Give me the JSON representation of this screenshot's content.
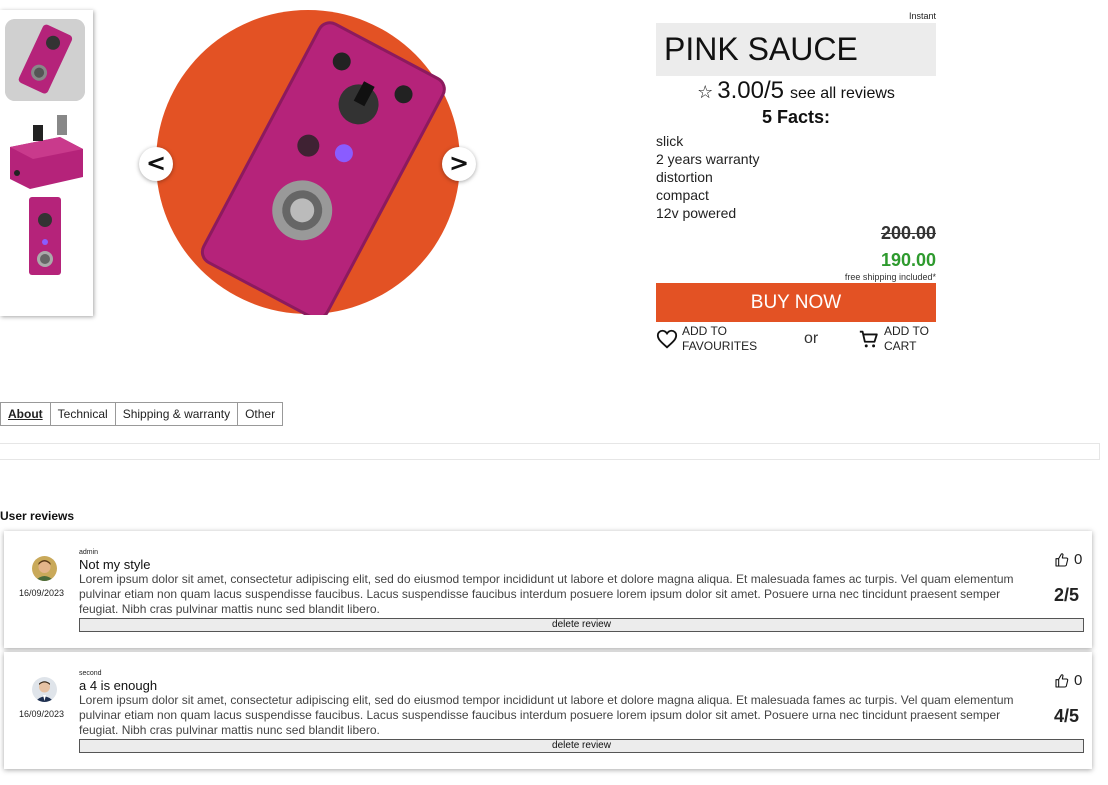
{
  "gallery": {
    "thumbnails": [
      "pedal-angled-icon",
      "pedal-side-icon",
      "pedal-top-icon"
    ],
    "prev_label": "<",
    "next_label": ">"
  },
  "product": {
    "badge": "Instant",
    "name": "PINK SAUCE",
    "rating_score": "3.00/5",
    "see_reviews_label": "see all reviews",
    "facts_title": "5 Facts:",
    "facts": [
      "slick",
      "2 years warranty",
      "distortion",
      "compact",
      "12v powered"
    ],
    "old_price": "200.00",
    "new_price": "190.00",
    "shipping_note": "free shipping included*",
    "buy_label": "BUY NOW",
    "favourites_label": "ADD TO FAVOURITES",
    "or_label": "or",
    "cart_label": "ADD TO CART"
  },
  "tabs": [
    "About",
    "Technical",
    "Shipping & warranty",
    "Other"
  ],
  "reviews_section": {
    "title": "User reviews",
    "items": [
      {
        "user": "admin",
        "date": "16/09/2023",
        "title": "Not my style",
        "body": "Lorem ipsum dolor sit amet, consectetur adipiscing elit, sed do eiusmod tempor incididunt ut labore et dolore magna aliqua. Et malesuada fames ac turpis. Vel quam elementum pulvinar etiam non quam lacus suspendisse faucibus. Lacus suspendisse faucibus interdum posuere lorem ipsum dolor sit amet. Posuere urna nec tincidunt praesent semper feugiat. Nibh cras pulvinar mattis nunc sed blandit libero.",
        "likes": "0",
        "score": "2/5",
        "delete_label": "delete review"
      },
      {
        "user": "second",
        "date": "16/09/2023",
        "title": "a 4 is enough",
        "body": "Lorem ipsum dolor sit amet, consectetur adipiscing elit, sed do eiusmod tempor incididunt ut labore et dolore magna aliqua. Et malesuada fames ac turpis. Vel quam elementum pulvinar etiam non quam lacus suspendisse faucibus. Lacus suspendisse faucibus interdum posuere lorem ipsum dolor sit amet. Posuere urna nec tincidunt praesent semper feugiat. Nibh cras pulvinar mattis nunc sed blandit libero.",
        "likes": "0",
        "score": "4/5",
        "delete_label": "delete review"
      }
    ]
  },
  "colors": {
    "accent": "#e35224",
    "price_green": "#2e9a2e",
    "pedal_pink": "#b5237a"
  }
}
